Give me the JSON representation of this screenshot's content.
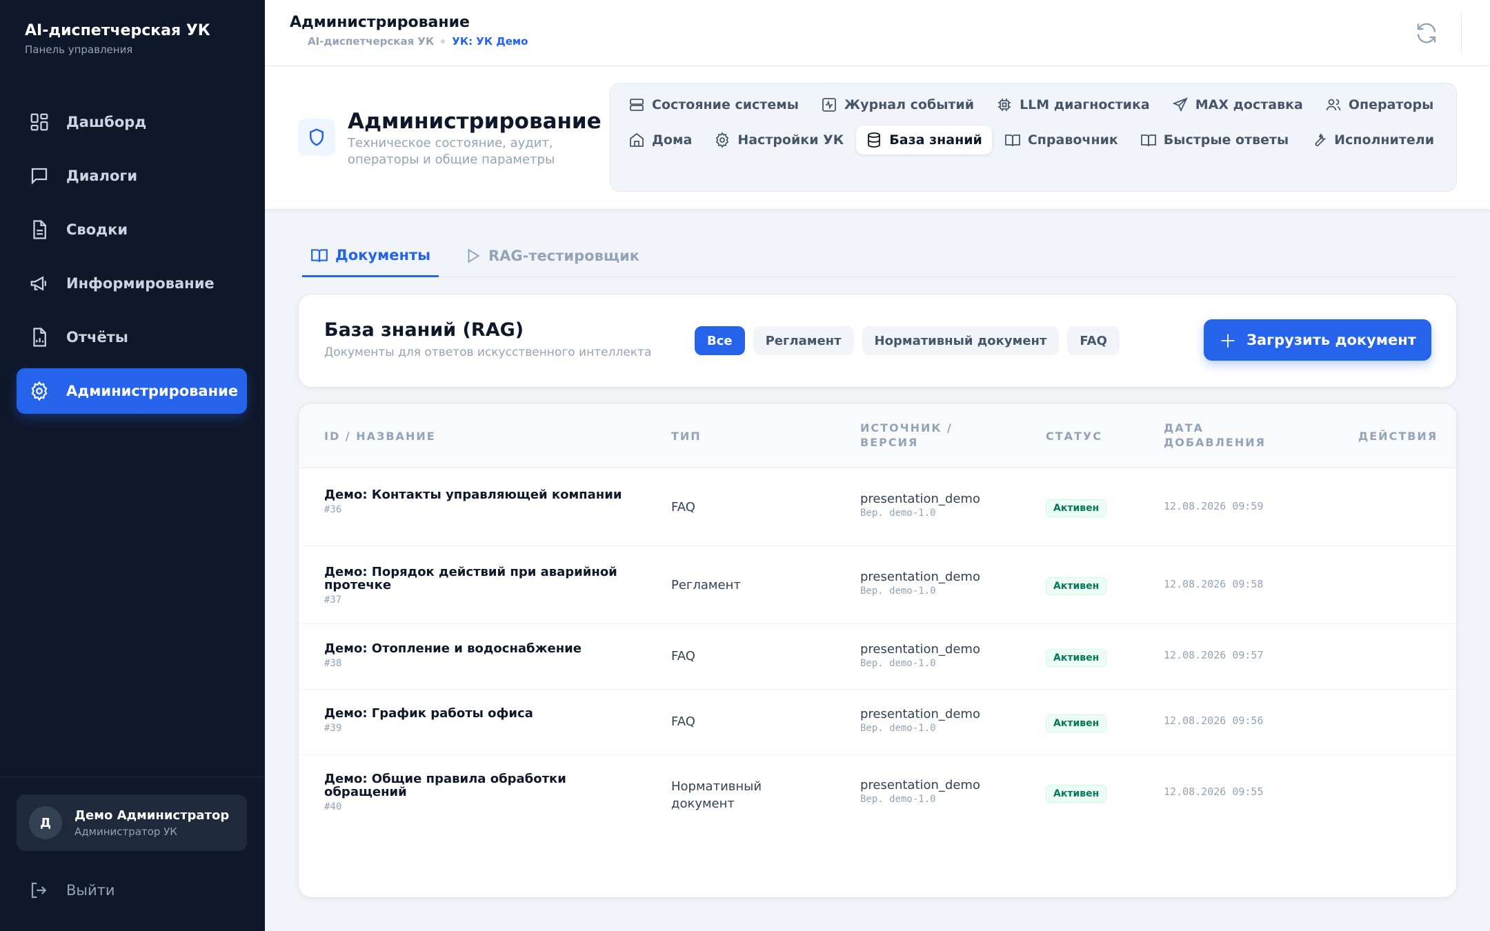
{
  "sidebar": {
    "brand_title": "AI-диспетчерская УК",
    "brand_subtitle": "Панель управления",
    "items": [
      {
        "label": "Дашборд",
        "icon": "dashboard-icon"
      },
      {
        "label": "Диалоги",
        "icon": "chat-icon"
      },
      {
        "label": "Сводки",
        "icon": "document-icon"
      },
      {
        "label": "Информирование",
        "icon": "megaphone-icon"
      },
      {
        "label": "Отчёты",
        "icon": "report-icon"
      },
      {
        "label": "Администрирование",
        "icon": "gear-icon",
        "active": true
      }
    ],
    "user": {
      "initial": "Д",
      "name": "Демо Администратор",
      "role": "Администратор УК"
    },
    "logout_label": "Выйти"
  },
  "topbar": {
    "title": "Администрирование",
    "breadcrumb": [
      "AI-диспетчерская УК",
      "УК: УК Демо"
    ]
  },
  "admin": {
    "title": "Администрирование",
    "description": "Техническое состояние, аудит, операторы и общие параметры",
    "tabs": [
      {
        "label": "Состояние системы",
        "icon": "server-icon"
      },
      {
        "label": "Журнал событий",
        "icon": "activity-icon"
      },
      {
        "label": "LLM диагностика",
        "icon": "cpu-icon"
      },
      {
        "label": "MAX доставка",
        "icon": "send-icon"
      },
      {
        "label": "Операторы",
        "icon": "users-icon"
      },
      {
        "label": "Дома",
        "icon": "home-icon"
      },
      {
        "label": "Настройки УК",
        "icon": "gear-icon"
      },
      {
        "label": "База знаний",
        "icon": "database-icon",
        "active": true
      },
      {
        "label": "Справочник",
        "icon": "book-icon"
      },
      {
        "label": "Быстрые ответы",
        "icon": "book-icon"
      },
      {
        "label": "Исполнители",
        "icon": "wrench-icon"
      }
    ]
  },
  "subtabs": [
    {
      "label": "Документы",
      "icon": "book-icon",
      "active": true
    },
    {
      "label": "RAG-тестировщик",
      "icon": "play-icon"
    }
  ],
  "kb": {
    "title": "База знаний (RAG)",
    "subtitle": "Документы для ответов искусственного интеллекта",
    "filters": [
      {
        "label": "Все",
        "active": true
      },
      {
        "label": "Регламент"
      },
      {
        "label": "Нормативный документ"
      },
      {
        "label": "FAQ"
      }
    ],
    "upload_label": "Загрузить документ"
  },
  "table": {
    "headers": {
      "name": "ID / НАЗВАНИЕ",
      "type": "ТИП",
      "source": "ИСТОЧНИК / ВЕРСИЯ",
      "status": "СТАТУС",
      "date": "ДАТА ДОБАВЛЕНИЯ",
      "actions": "ДЕЙСТВИЯ"
    },
    "rows": [
      {
        "title": "Демо: Контакты управляющей компании",
        "id": "#36",
        "type": "FAQ",
        "source": "presentation_demo",
        "version": "Вер. demo-1.0",
        "status": "Активен",
        "date": "12.08.2026 09:59"
      },
      {
        "title": "Демо: Порядок действий при аварийной протечке",
        "id": "#37",
        "type": "Регламент",
        "source": "presentation_demo",
        "version": "Вер. demo-1.0",
        "status": "Активен",
        "date": "12.08.2026 09:58"
      },
      {
        "title": "Демо: Отопление и водоснабжение",
        "id": "#38",
        "type": "FAQ",
        "source": "presentation_demo",
        "version": "Вер. demo-1.0",
        "status": "Активен",
        "date": "12.08.2026 09:57"
      },
      {
        "title": "Демо: График работы офиса",
        "id": "#39",
        "type": "FAQ",
        "source": "presentation_demo",
        "version": "Вер. demo-1.0",
        "status": "Активен",
        "date": "12.08.2026 09:56"
      },
      {
        "title": "Демо: Общие правила обработки обращений",
        "id": "#40",
        "type": "Нормативный документ",
        "source": "presentation_demo",
        "version": "Вер. demo-1.0",
        "status": "Активен",
        "date": "12.08.2026 09:55"
      }
    ]
  },
  "colors": {
    "accent": "#2563eb",
    "sidebar": "#0f172a",
    "success": "#047857"
  }
}
